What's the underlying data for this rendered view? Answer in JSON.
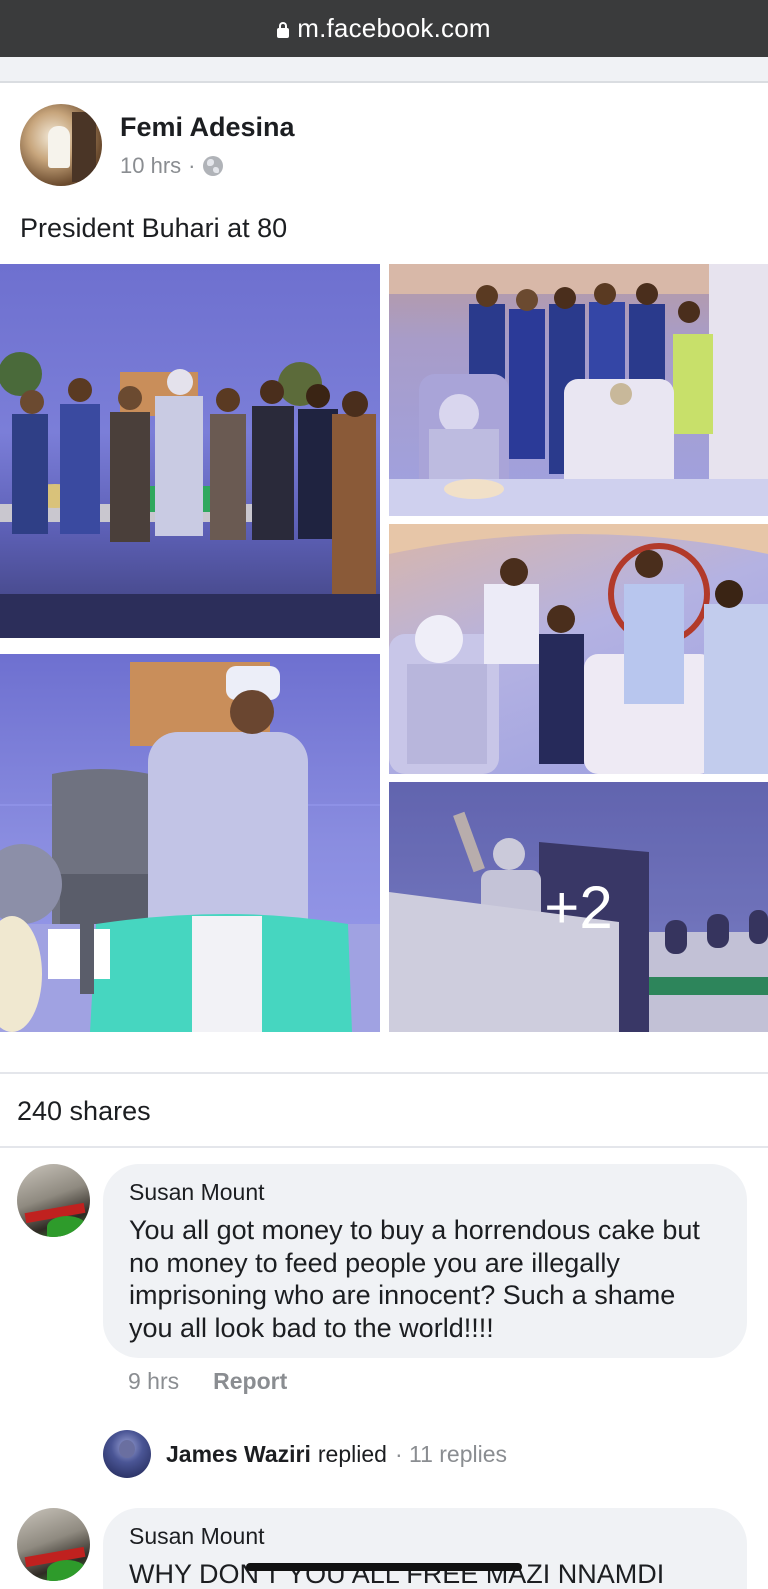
{
  "browser": {
    "url": "m.facebook.com"
  },
  "post": {
    "author": "Femi Adesina",
    "time": "10 hrs",
    "separator": "·",
    "text": "President Buhari at 80",
    "more_photos": "+2",
    "shares": "240 shares"
  },
  "comments": [
    {
      "author": "Susan Mount",
      "text": "You all got money to buy a horrendous cake but no money to feed people you are illegally imprisoning who are innocent? Such a shame you all look bad to the world!!!!",
      "time": "9 hrs",
      "report_label": "Report",
      "reply": {
        "name": "James Waziri",
        "verb": "replied",
        "count": "· 11 replies"
      }
    },
    {
      "author": "Susan Mount",
      "text": "WHY DON'T YOU ALL FREE MAZI NNAMDI"
    }
  ],
  "colors": {
    "url_bar": "#3a3b3c",
    "bubble": "#f0f2f5",
    "muted_text": "#8a8d91"
  }
}
